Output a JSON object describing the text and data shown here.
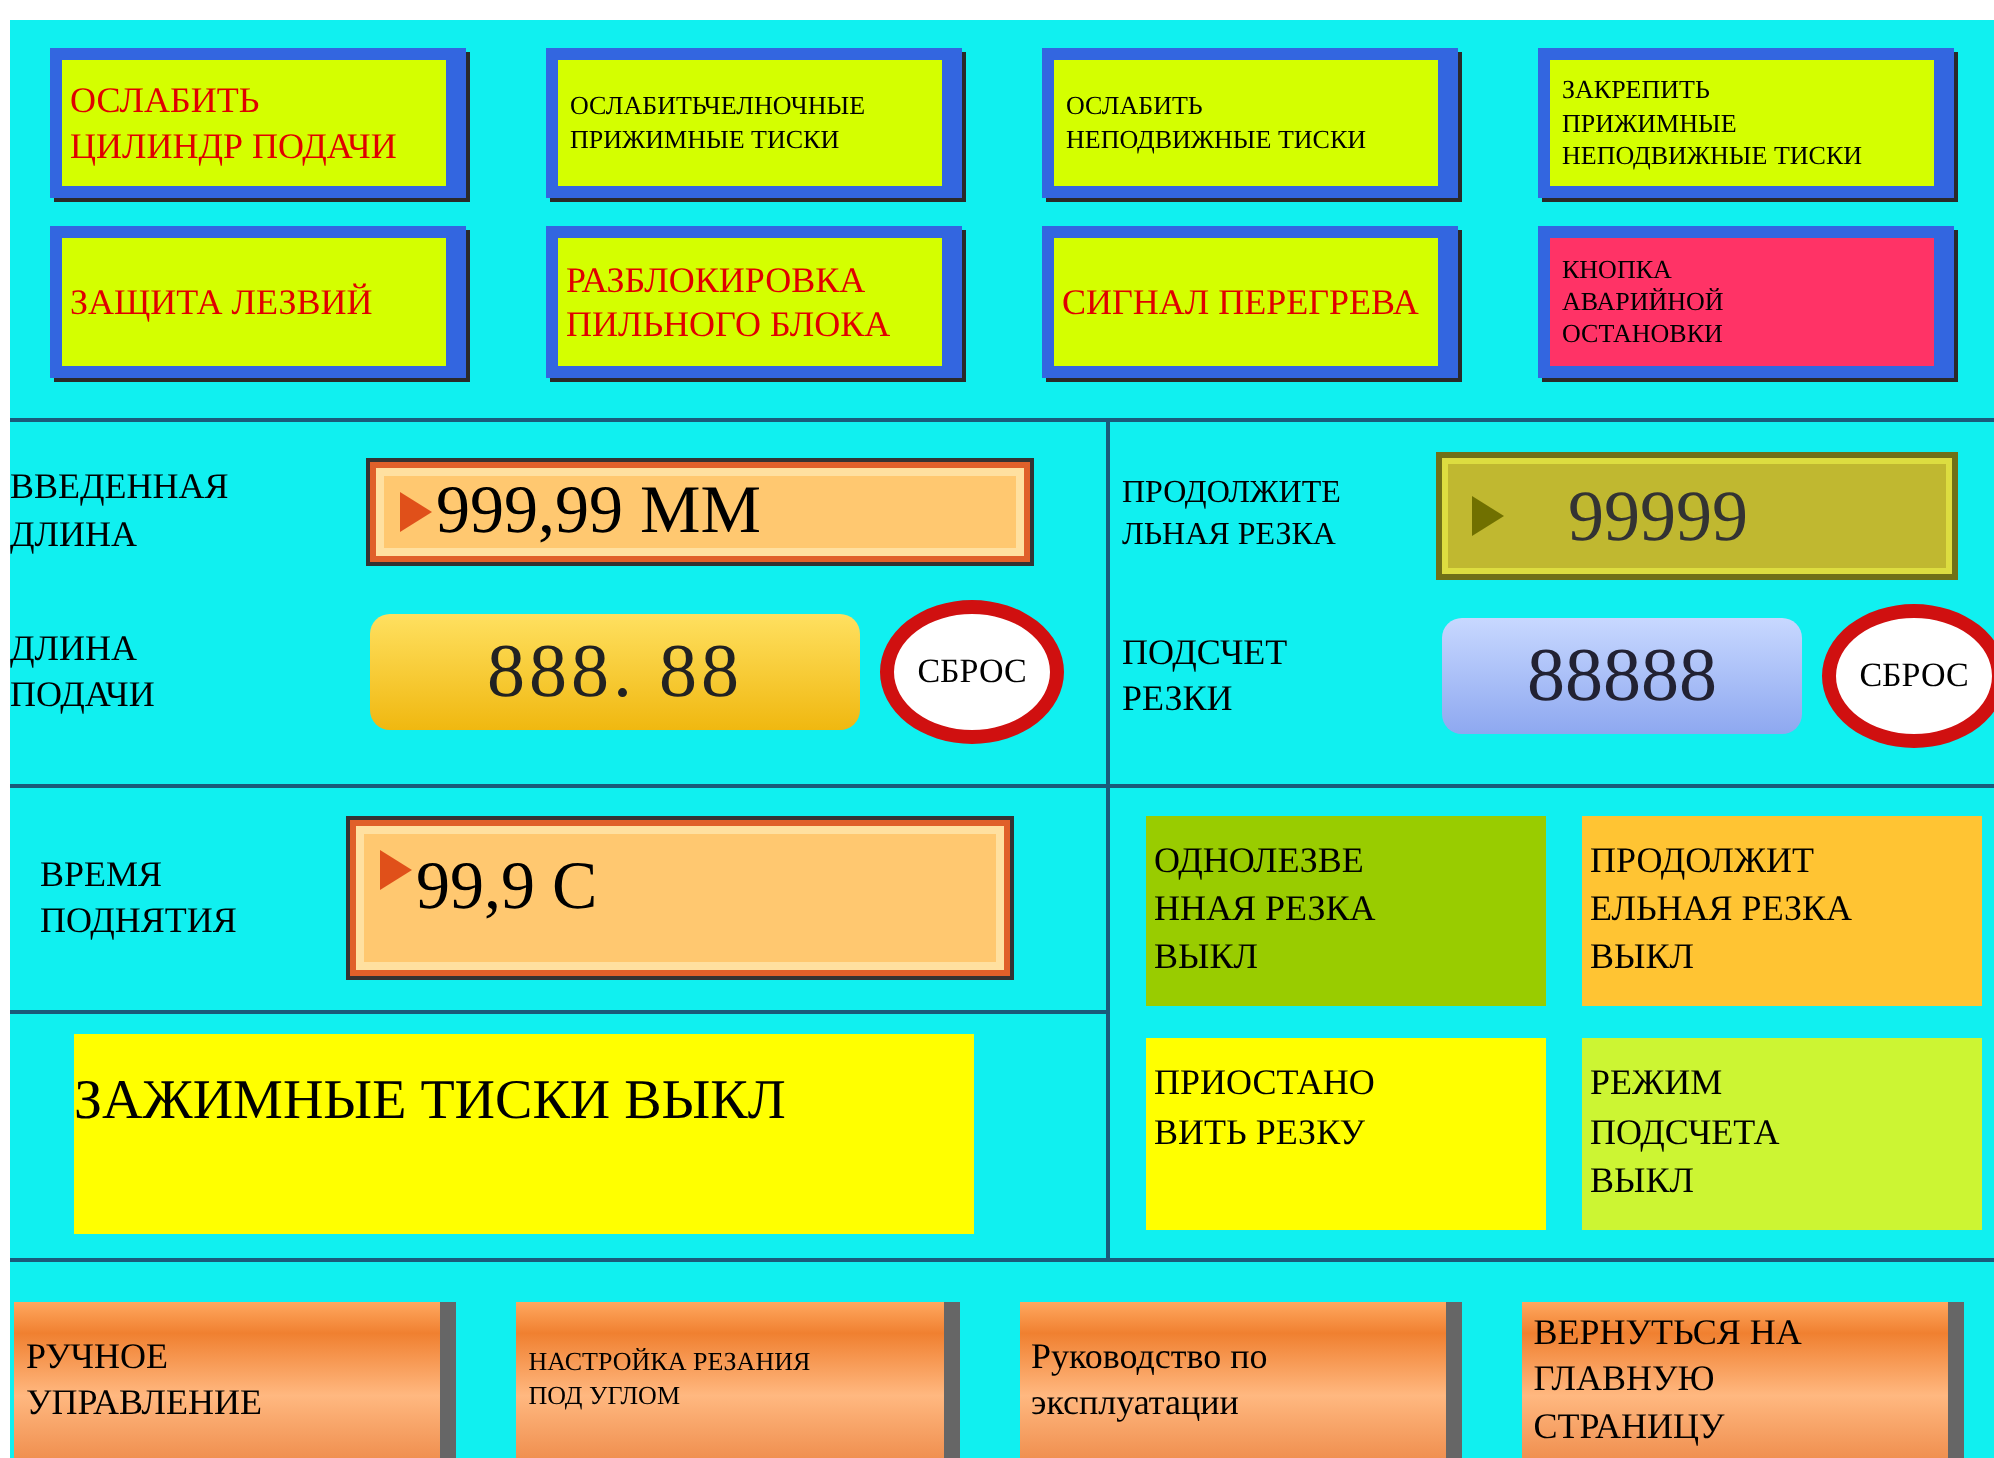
{
  "control_buttons": [
    {
      "label": "ОСЛАБИТЬ ЦИЛИНДР ПОДАЧИ",
      "kind": "alert"
    },
    {
      "label": "ОСЛАБИТЬЧЕЛНОЧНЫЕ ПРИЖИМНЫЕ ТИСКИ",
      "kind": "plain"
    },
    {
      "label": "ОСЛАБИТЬ НЕПОДВИЖНЫЕ ТИСКИ",
      "kind": "plain"
    },
    {
      "label": "ЗАКРЕПИТЬ ПРИЖИМНЫЕ НЕПОДВИЖНЫЕ ТИСКИ",
      "kind": "plain"
    },
    {
      "label": "ЗАЩИТА ЛЕЗВИЙ",
      "kind": "alert"
    },
    {
      "label": "РАЗБЛОКИРОВКА ПИЛЬНОГО БЛОКА",
      "kind": "alert"
    },
    {
      "label": "СИГНАЛ ПЕРЕГРЕВА",
      "kind": "alert"
    },
    {
      "label": "КНОПКА АВАРИЙНОЙ ОСТАНОВКИ",
      "kind": "emergency"
    }
  ],
  "entered_length": {
    "label": "ВВЕДЕННАЯ ДЛИНА",
    "value": "999,99 ММ"
  },
  "continuous_cutting": {
    "label": "ПРОДОЛЖИТЕ ЛЬНАЯ РЕЗКА",
    "value": "99999"
  },
  "feed_length": {
    "label": "ДЛИНА ПОДАЧИ",
    "value": "888. 88",
    "reset": "СБРОС"
  },
  "cut_count": {
    "label": "ПОДСЧЕТ РЕЗКИ",
    "value": "88888",
    "reset": "СБРОС"
  },
  "lift_time": {
    "label": "ВРЕМЯ ПОДНЯТИЯ",
    "value": "99,9 С"
  },
  "clamp_status": "ЗАЖИМНЫЕ ТИСКИ ВЫКЛ",
  "mode_buttons": [
    {
      "label": "ОДНОЛЕЗВЕ ННАЯ РЕЗКА ВЫКЛ",
      "color": "#99cc00"
    },
    {
      "label": "ПРОДОЛЖИТ ЕЛЬНАЯ РЕЗКА ВЫКЛ",
      "color": "#ffc433"
    },
    {
      "label": "ПРИОСТАНО ВИТЬ РЕЗКУ",
      "color": "#ffff00"
    },
    {
      "label": "РЕЖИМ ПОДСЧЕТА ВЫКЛ",
      "color": "#ccf533"
    }
  ],
  "nav_buttons": [
    {
      "label": "РУЧНОЕ УПРАВЛЕНИЕ"
    },
    {
      "label": "НАСТРОЙКА РЕЗАНИЯ ПОД УГЛОМ"
    },
    {
      "label": "Руководство по эксплуатации"
    },
    {
      "label": "ВЕРНУТЬСЯ НА ГЛАВНУЮ СТРАНИЦУ"
    }
  ]
}
